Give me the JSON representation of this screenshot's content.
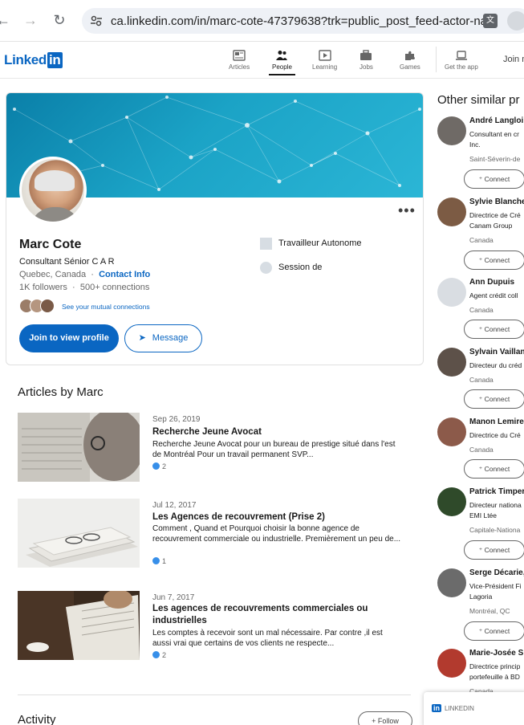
{
  "browser": {
    "url": "ca.linkedin.com/in/marc-cote-47379638?trk=public_post_feed-actor-na..."
  },
  "nav": {
    "items": [
      {
        "label": "Articles"
      },
      {
        "label": "People"
      },
      {
        "label": "Learning"
      },
      {
        "label": "Jobs"
      },
      {
        "label": "Games"
      },
      {
        "label": "Get the app"
      }
    ],
    "active": "People",
    "join": "Join n"
  },
  "profile": {
    "name": "Marc Cote",
    "headline": "Consultant Sénior C A R",
    "location": "Quebec, Canada",
    "contact": "Contact Info",
    "followers": "1K followers",
    "connections": "500+ connections",
    "mutual": "See your mutual connections",
    "join_btn": "Join to view profile",
    "message_btn": "Message",
    "experience": [
      "Travailleur Autonome",
      "Session de"
    ],
    "separator": "·"
  },
  "articles": {
    "section_title": "Articles by Marc",
    "items": [
      {
        "date": "Sep 26, 2019",
        "title": "Recherche Jeune Avocat",
        "desc": "Recherche Jeune Avocat pour un bureau de prestige situé dans l'est de Montréal Pour un travail permanent SVP...",
        "reactions": "2"
      },
      {
        "date": "Jul 12, 2017",
        "title": "Les Agences de recouvrement (Prise 2)",
        "desc": "Comment , Quand et Pourquoi choisir la bonne agence de recouvrement commerciale ou industrielle. Premièrement un peu de...",
        "reactions": "1"
      },
      {
        "date": "Jun 7, 2017",
        "title": "Les agences de recouvrements commerciales ou industrielles",
        "desc": "Les comptes à recevoir sont un mal nécessaire. Par contre ,il est aussi vrai que certains de vos clients ne respecte...",
        "reactions": "2"
      }
    ]
  },
  "activity": {
    "title": "Activity",
    "follow": "Follow"
  },
  "similar": {
    "title": "Other similar pr",
    "connect_label": "Connect",
    "people": [
      {
        "name": "André Langloi",
        "role": [
          "Consultant en cr",
          "Inc."
        ],
        "loc": "Saint-Séverin-de"
      },
      {
        "name": "Sylvie Blanche",
        "role": [
          "Directrice de Cré",
          "Canam Group"
        ],
        "loc": "Canada"
      },
      {
        "name": "Ann Dupuis",
        "role": [
          "Agent crédit coll"
        ],
        "loc": "Canada"
      },
      {
        "name": "Sylvain Vaillan",
        "role": [
          "Directeur du créd"
        ],
        "loc": "Canada"
      },
      {
        "name": "Manon Lemire",
        "role": [
          "Directrice du Cré"
        ],
        "loc": "Canada"
      },
      {
        "name": "Patrick Timper",
        "role": [
          "Directeur nationa",
          "EMI Ltée"
        ],
        "loc": "Capitale-Nationa"
      },
      {
        "name": "Serge Décarie,",
        "role": [
          "Vice-Président Fi",
          "Lagoria"
        ],
        "loc": "Montréal, QC"
      },
      {
        "name": "Marie-Josée S",
        "role": [
          "Directrice princip",
          "portefeuille à BD"
        ],
        "loc": "Canada"
      }
    ]
  },
  "toast": {
    "brand": "in",
    "text": "LINKEDIN"
  }
}
